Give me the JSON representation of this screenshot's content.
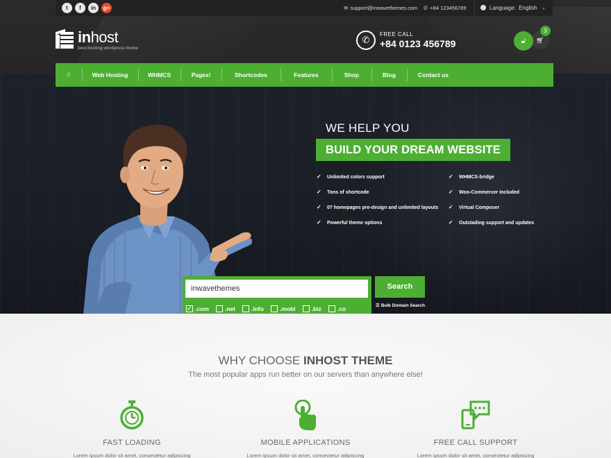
{
  "colors": {
    "accent": "#4caf32",
    "dark": "#222222",
    "hero_bg": "#1d2129"
  },
  "topbar": {
    "social": [
      {
        "icon": "twitter-icon",
        "glyph": "t"
      },
      {
        "icon": "facebook-icon",
        "glyph": "f"
      },
      {
        "icon": "linkedin-icon",
        "glyph": "in"
      },
      {
        "icon": "google-plus-icon",
        "glyph": "g+"
      }
    ],
    "email": "support@inwavethemes.com",
    "phone": "+84 123456789",
    "language_label": "Language:",
    "language_value": "English"
  },
  "logo": {
    "brand_bold": "in",
    "brand_rest": "host",
    "tagline": "best hosting wordpress theme"
  },
  "call": {
    "label": "FREE CALL",
    "number": "+84 0123 456789"
  },
  "cart": {
    "count": "3"
  },
  "nav": {
    "items": [
      "Web Hosting",
      "WHMCS",
      "Pages!",
      "Shortcodes",
      "Features",
      "Shop",
      "Blog",
      "Contact us"
    ]
  },
  "hero": {
    "subtitle": "WE HELP YOU",
    "title": "BUILD YOUR DREAM WEBSITE",
    "features": [
      "Unlimited colors support",
      "WHMCS-bridge",
      "Tons of shortcode",
      "Woo-Commercer included",
      "07 homepages pre-design and unlimited layouts",
      "Virtual Composer",
      "Powerful theme options",
      "Outstading support and updates"
    ]
  },
  "domain_search": {
    "value": "inwavethemes",
    "button": "Search",
    "bulk_label": "Bulk Domain Search",
    "tlds": [
      {
        "label": ".com",
        "checked": true
      },
      {
        "label": ".net",
        "checked": false
      },
      {
        "label": ".info",
        "checked": false
      },
      {
        "label": ".mobi",
        "checked": false
      },
      {
        "label": ".biz",
        "checked": false
      },
      {
        "label": ".co",
        "checked": false
      }
    ]
  },
  "why": {
    "title_light": "WHY CHOOSE ",
    "title_bold": "INHOST THEME",
    "subtitle": "The most popular apps run better on our servers than anywhere else!",
    "columns": [
      {
        "icon": "stopwatch-icon",
        "title": "FAST LOADING",
        "text": "Lorem ipsum dolor sit amet, consectetur adipiscing"
      },
      {
        "icon": "touch-hand-icon",
        "title": "MOBILE APPLICATIONS",
        "text": "Lorem ipsum dolor sit amet, consectetur adipiscing"
      },
      {
        "icon": "phone-chat-icon",
        "title": "FREE CALL SUPPORT",
        "text": "Lorem ipsum dolor sit amet, consectetur adipiscing"
      }
    ]
  }
}
